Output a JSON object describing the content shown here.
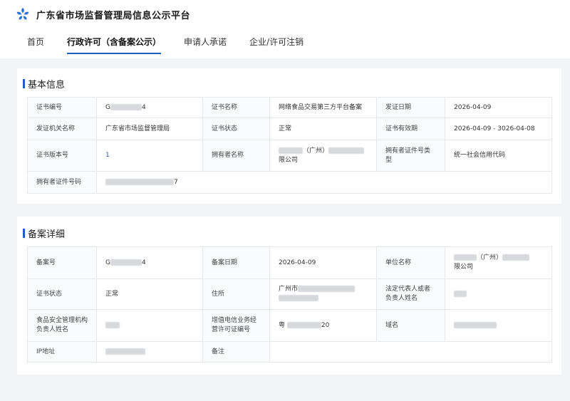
{
  "header": {
    "site_title": "广东省市场监督管理局信息公示平台",
    "logo_icon": "flower-logo-icon",
    "brand_color": "#2a6fd6"
  },
  "nav": [
    {
      "label": "首页",
      "active": false
    },
    {
      "label": "行政许可（含备案公示）",
      "active": true
    },
    {
      "label": "申请人承诺",
      "active": false
    },
    {
      "label": "企业/许可注销",
      "active": false
    }
  ],
  "basic": {
    "title": "基本信息",
    "cert_no_label": "证书编号",
    "cert_no_prefix": "G",
    "cert_no_suffix": "4",
    "cert_name_label": "证书名称",
    "cert_name": "网络食品交易第三方平台备案",
    "issue_date_label": "发证日期",
    "issue_date": "2026-04-09",
    "issuer_label": "发证机关名称",
    "issuer": "广东省市场监督管理局",
    "status_label": "证书状态",
    "status": "正常",
    "validity_label": "证书有效期",
    "validity": "2026-04-09 - 3026-04-08",
    "version_label": "证书版本号",
    "version": "1",
    "holder_label": "拥有者名称",
    "holder_mid": "（广州）",
    "holder_suffix": "限公司",
    "id_type_label": "拥有者证件号类型",
    "id_type": "统一社会信用代码",
    "id_no_label": "拥有者证件号码",
    "id_no_suffix": "7"
  },
  "detail": {
    "title": "备案详细",
    "record_no_label": "备案号",
    "record_no_prefix": "G",
    "record_no_suffix": "4",
    "record_date_label": "备案日期",
    "record_date": "2026-04-09",
    "unit_label": "单位名称",
    "unit_mid": "（广州）",
    "unit_suffix": "限公司",
    "status_label": "证书状态",
    "status": "正常",
    "address_label": "住所",
    "address_prefix": "广州市",
    "legal_label": "法定代表人或者负责人姓名",
    "food_mgr_label": "食品安全管理机构负责人姓名",
    "icp_label": "增值电信业务经营许可证编号",
    "icp_prefix": "粤",
    "icp_suffix": "20",
    "domain_label": "域名",
    "ip_label": "IP地址",
    "remark_label": "备注"
  }
}
